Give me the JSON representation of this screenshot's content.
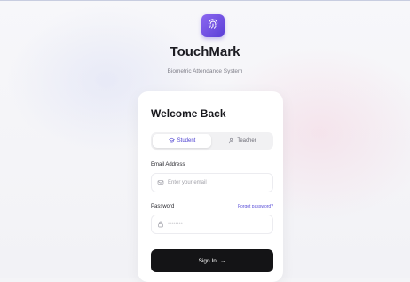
{
  "app": {
    "name": "TouchMark",
    "tagline": "Biometric Attendance System"
  },
  "login": {
    "heading": "Welcome Back",
    "roles": [
      {
        "label": "Student",
        "icon": "graduation-cap-icon",
        "active": true
      },
      {
        "label": "Teacher",
        "icon": "user-icon",
        "active": false
      }
    ],
    "email": {
      "label": "Email Address",
      "placeholder": "Enter your email",
      "icon": "mail-icon"
    },
    "password": {
      "label": "Password",
      "masked_value": "••••••••",
      "icon": "lock-icon",
      "forgot_label": "Forgot password?"
    },
    "submit_label": "Sign In",
    "submit_arrow": "→"
  },
  "colors": {
    "brand": "#6a4de6",
    "primary_button": "#141416",
    "link": "#5a4fd8"
  }
}
